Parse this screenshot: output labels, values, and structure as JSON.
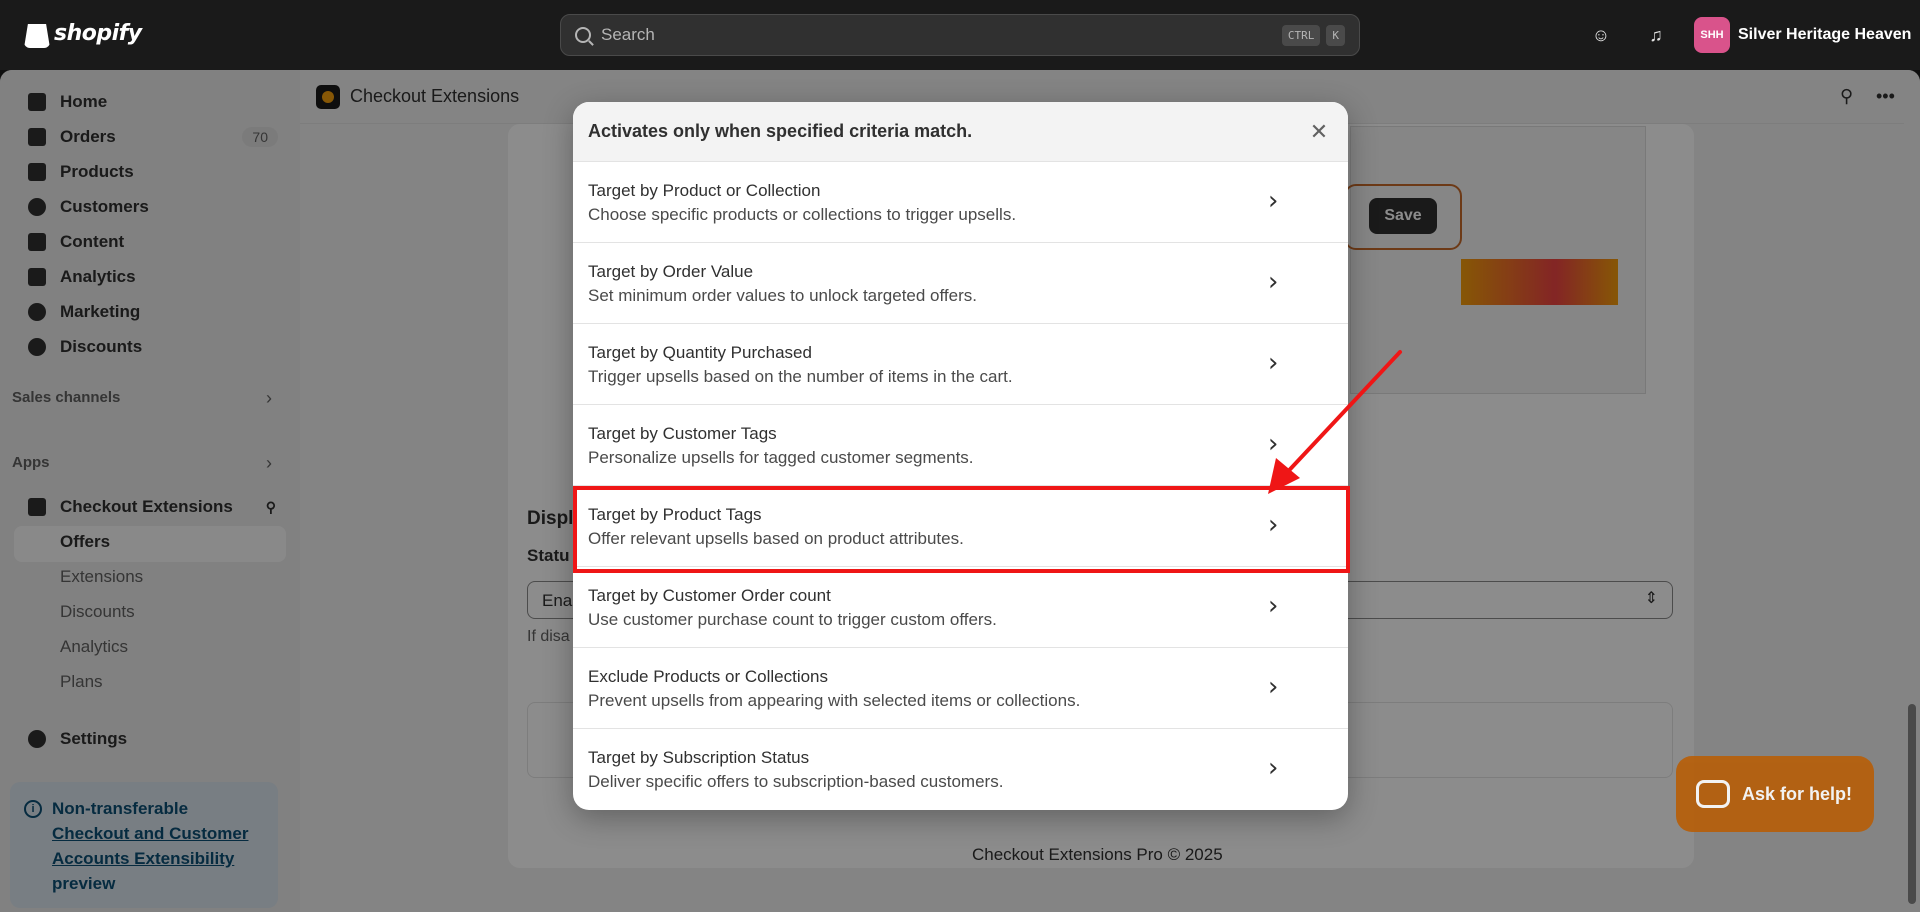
{
  "topbar": {
    "brand": "shopify",
    "search_placeholder": "Search",
    "shortcut_keys": [
      "CTRL",
      "K"
    ],
    "store_initials": "SHH",
    "store_name": "Silver Heritage Heaven"
  },
  "sidebar": {
    "items": [
      {
        "label": "Home",
        "icon": "home-icon"
      },
      {
        "label": "Orders",
        "icon": "orders-icon",
        "badge": "70"
      },
      {
        "label": "Products",
        "icon": "tag-icon"
      },
      {
        "label": "Customers",
        "icon": "person-icon"
      },
      {
        "label": "Content",
        "icon": "image-icon"
      },
      {
        "label": "Analytics",
        "icon": "bar-chart-icon"
      },
      {
        "label": "Marketing",
        "icon": "target-icon"
      },
      {
        "label": "Discounts",
        "icon": "discount-icon"
      }
    ],
    "sales_channels": "Sales channels",
    "apps": "Apps",
    "app_name": "Checkout Extensions",
    "app_sub_items": [
      "Offers",
      "Extensions",
      "Discounts",
      "Analytics",
      "Plans"
    ],
    "settings": "Settings",
    "notice": {
      "lead": "Non-transferable",
      "link": "Checkout and Customer Accounts Extensibility",
      "tail": "preview"
    }
  },
  "app_header": {
    "title": "Checkout Extensions"
  },
  "background": {
    "display_heading": "Displ",
    "status_label": "Statu",
    "select_value": "Enal",
    "helper": "If disa",
    "preview_save": "Save",
    "footer": "Checkout Extensions Pro © 2025",
    "help_button": "Ask for help!"
  },
  "modal": {
    "title": "Activates only when specified criteria match.",
    "options": [
      {
        "title": "Target by Product or Collection",
        "desc": "Choose specific products or collections to trigger upsells."
      },
      {
        "title": "Target by Order Value",
        "desc": "Set minimum order values to unlock targeted offers."
      },
      {
        "title": "Target by Quantity Purchased",
        "desc": "Trigger upsells based on the number of items in the cart."
      },
      {
        "title": "Target by Customer Tags",
        "desc": "Personalize upsells for tagged customer segments."
      },
      {
        "title": "Target by Product Tags",
        "desc": "Offer relevant upsells based on product attributes."
      },
      {
        "title": "Target by Customer Order count",
        "desc": "Use customer purchase count to trigger custom offers."
      },
      {
        "title": "Exclude Products or Collections",
        "desc": "Prevent upsells from appearing with selected items or collections."
      },
      {
        "title": "Target by Subscription Status",
        "desc": "Deliver specific offers to subscription-based customers."
      }
    ]
  },
  "colors": {
    "highlight": "#ef1616",
    "help_button": "#b85e07",
    "store_avatar": "#d9538b",
    "notice_bg": "#dbe6ee"
  }
}
